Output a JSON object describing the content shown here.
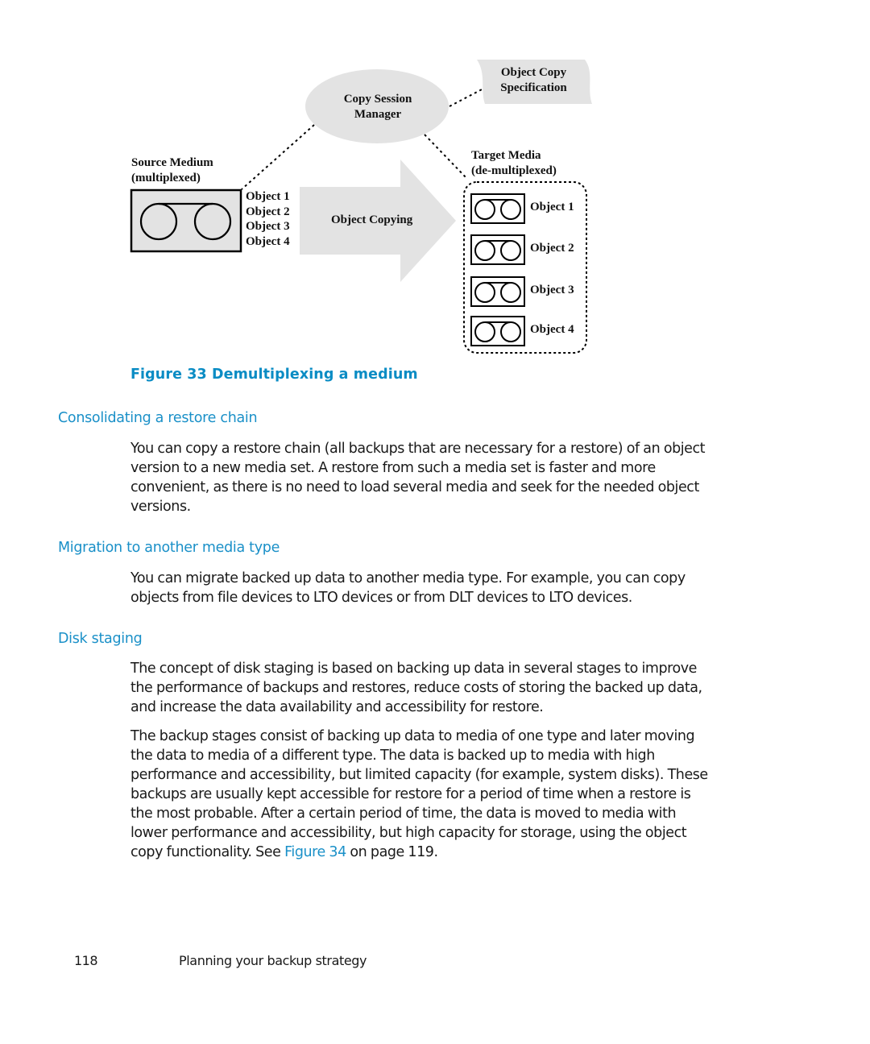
{
  "figure": {
    "copy_session_manager": [
      "Copy Session",
      "Manager"
    ],
    "object_copy_specification": [
      "Object Copy",
      "Specification"
    ],
    "source_medium": [
      "Source Medium",
      "(multiplexed)"
    ],
    "source_objects": [
      "Object 1",
      "Object 2",
      "Object 3",
      "Object 4"
    ],
    "arrow_label": "Object Copying",
    "target_media": [
      "Target Media",
      "(de-multiplexed)"
    ],
    "target_objects": [
      "Object 1",
      "Object 2",
      "Object 3",
      "Object 4"
    ],
    "caption": "Figure 33 Demultiplexing a medium"
  },
  "sections": [
    {
      "heading": "Consolidating a restore chain",
      "paragraphs": [
        "You can copy a restore chain (all backups that are necessary for a restore) of an object version to a new media set. A restore from such a media set is faster and more convenient, as there is no need to load several media and seek for the needed object versions."
      ]
    },
    {
      "heading": "Migration to another media type",
      "paragraphs": [
        "You can migrate backed up data to another media type. For example, you can copy objects from file devices to LTO devices or from DLT devices to LTO devices."
      ]
    },
    {
      "heading": "Disk staging",
      "paragraphs": [
        "The concept of disk staging is based on backing up data in several stages to improve the performance of backups and restores, reduce costs of storing the backed up data, and increase the data availability and accessibility for restore.",
        "The backup stages consist of backing up data to media of one type and later moving the data to media of a different type. The data is backed up to media with high performance and accessibility, but limited capacity (for example, system disks). These backups are usually kept accessible for restore for a period of time when a restore is the most probable. After a certain period of time, the data is moved to media with lower performance and accessibility, but high capacity for storage, using the object copy functionality. See"
      ],
      "link_text": "Figure 34",
      "after_link": " on page 119."
    }
  ],
  "footer": {
    "page_number": "118",
    "chapter_title": "Planning your backup strategy"
  },
  "colors": {
    "heading": "#1a90c8",
    "caption": "#0a8cc4",
    "shape_fill": "#e3e3e3"
  }
}
